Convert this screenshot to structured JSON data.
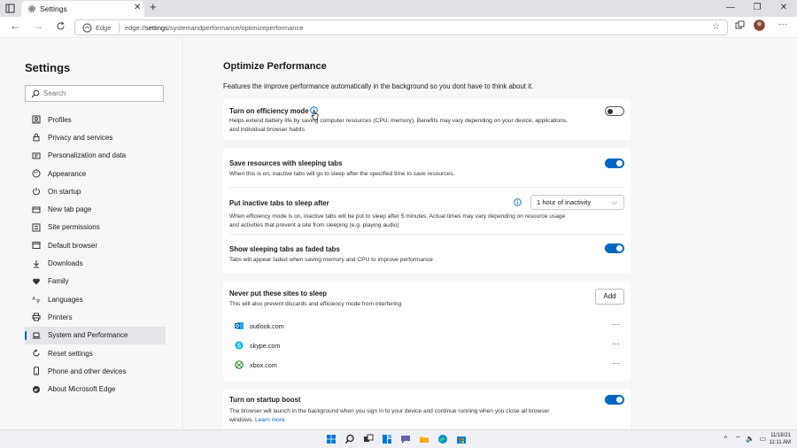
{
  "browser": {
    "tab_title": "Settings",
    "new_tab_symbol": "+",
    "close_symbol": "✕",
    "window_controls": [
      "—",
      "❐",
      "✕"
    ],
    "address": {
      "label": "Edge",
      "url_prefix": "edge://",
      "url_bold": "settings",
      "url_rest": "/systemandperformance/optimizeperformance"
    }
  },
  "sidebar": {
    "title": "Settings",
    "search_placeholder": "Search",
    "items": [
      {
        "label": "Profiles",
        "icon": "profile-icon"
      },
      {
        "label": "Privacy and services",
        "icon": "lock-icon"
      },
      {
        "label": "Personalization and data",
        "icon": "personalization-icon"
      },
      {
        "label": "Appearance",
        "icon": "palette-icon"
      },
      {
        "label": "On startup",
        "icon": "power-icon"
      },
      {
        "label": "New tab page",
        "icon": "newtab-icon"
      },
      {
        "label": "Site permissions",
        "icon": "permissions-icon"
      },
      {
        "label": "Default browser",
        "icon": "browser-icon"
      },
      {
        "label": "Downloads",
        "icon": "download-icon"
      },
      {
        "label": "Family",
        "icon": "heart-icon"
      },
      {
        "label": "Languages",
        "icon": "language-icon"
      },
      {
        "label": "Printers",
        "icon": "printer-icon"
      },
      {
        "label": "System and Performance",
        "icon": "laptop-icon",
        "active": true
      },
      {
        "label": "Reset settings",
        "icon": "reset-icon"
      },
      {
        "label": "Phone and other devices",
        "icon": "phone-icon"
      },
      {
        "label": "About Microsoft Edge",
        "icon": "edge-icon"
      }
    ]
  },
  "main": {
    "title": "Optimize Performance",
    "description": "Features the improve performance automatically in the background so you dont have to think about it.",
    "efficiency": {
      "title": "Turn on efficiency mode",
      "desc_line1": "Helps extend battery life by saving computer resources (CPU, memory). Benefits may vary depending on your device, applications,",
      "desc_line2": "and individual browser habits",
      "enabled": false
    },
    "sleeping": {
      "title": "Save resources with sleeping tabs",
      "desc": "When this is on, inactive tabs will go to sleep after the specified time to save resources.",
      "enabled": true
    },
    "inactive": {
      "title": "Put inactive tabs to sleep after",
      "value": "1 hour of inactivity",
      "desc_line1": "When efficiency mode is on, inactive tabs will be put to sleep after 5 minutes. Actual times may vary depending on resource usage",
      "desc_line2": "and activities that prevent a site from sleeping (e.g. playing audio)"
    },
    "faded": {
      "title": "Show sleeping tabs as faded tabs",
      "desc": "Tabs will appear faded when saving memory and CPU to improve performance",
      "enabled": true
    },
    "never_sleep": {
      "title": "Never put these sites to sleep",
      "desc": "This will also prevent discards and efficiency mode from interfering",
      "add_label": "Add",
      "more_symbol": "···",
      "sites": [
        {
          "name": "outlook.com",
          "icon": "outlook-icon",
          "color": "#0f6cbd"
        },
        {
          "name": "skype.com",
          "icon": "skype-icon",
          "color": "#00aff0"
        },
        {
          "name": "xbox.com",
          "icon": "xbox-icon",
          "color": "#2e8b2e"
        }
      ]
    },
    "startup_boost": {
      "title": "Turn on startup boost",
      "desc_line1": "The browser will launch in the background when you sign in to your device and continue running when you close all browser",
      "desc_line2": "windows.",
      "link": "Learn more",
      "enabled": true
    }
  },
  "taskbar": {
    "tray_symbol": "^",
    "time": "11:11 AM",
    "date": "11/18/21"
  },
  "colors": {
    "accent": "#0067c0"
  }
}
